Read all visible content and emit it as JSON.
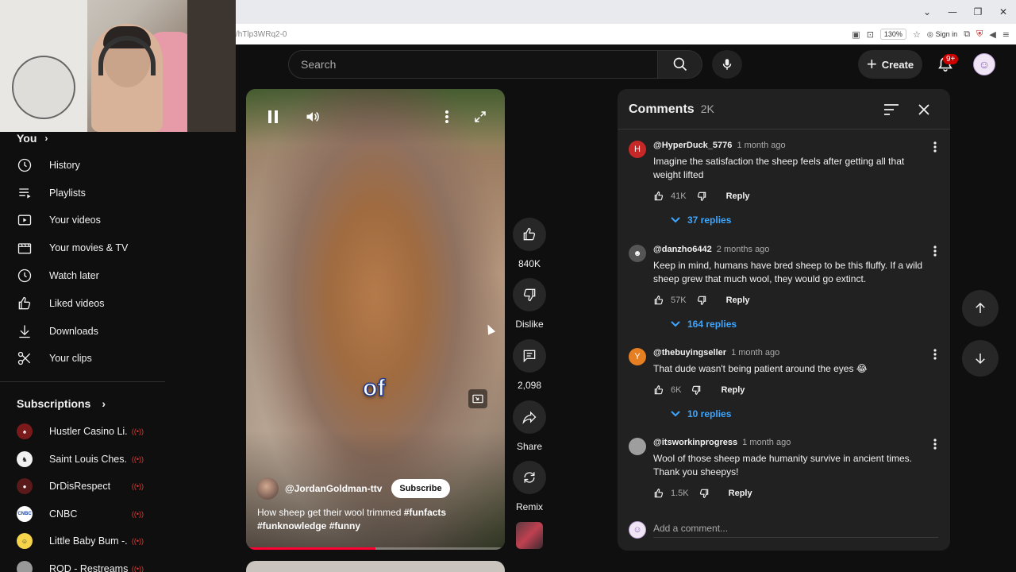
{
  "browser": {
    "url": "/hTlp3WRq2-0",
    "zoom": "130%",
    "sign_in": "Sign in"
  },
  "header": {
    "search_placeholder": "Search",
    "create_label": "Create",
    "notifications_badge": "9+"
  },
  "sidebar": {
    "you_label": "You",
    "items": [
      {
        "label": "History",
        "icon": "history-icon"
      },
      {
        "label": "Playlists",
        "icon": "playlists-icon"
      },
      {
        "label": "Your videos",
        "icon": "your-videos-icon"
      },
      {
        "label": "Your movies & TV",
        "icon": "movies-icon"
      },
      {
        "label": "Watch later",
        "icon": "clock-icon"
      },
      {
        "label": "Liked videos",
        "icon": "thumbs-up-icon"
      },
      {
        "label": "Downloads",
        "icon": "download-icon"
      },
      {
        "label": "Your clips",
        "icon": "scissors-icon"
      }
    ],
    "subscriptions_label": "Subscriptions",
    "subscriptions": [
      {
        "name": "Hustler Casino Li...",
        "color": "#7a1a1a"
      },
      {
        "name": "Saint Louis Ches...",
        "color": "#f1f1f1"
      },
      {
        "name": "DrDisRespect",
        "color": "#5a1a1a"
      },
      {
        "name": "CNBC",
        "color": "#ffffff"
      },
      {
        "name": "Little Baby Bum -...",
        "color": "#f5d34a"
      },
      {
        "name": "ROD - Restreams",
        "color": "#999999"
      }
    ]
  },
  "video": {
    "caption": "of",
    "channel": "@JordanGoldman-ttv",
    "subscribe_label": "Subscribe",
    "title_text": "How sheep get their wool trimmed ",
    "hashtag1": "#funfacts",
    "hashtag2": "#funknowledge",
    "hashtag3": "#funny",
    "progress": 0.5
  },
  "actions": {
    "likes": "840K",
    "dislike_label": "Dislike",
    "comments": "2,098",
    "share_label": "Share",
    "remix_label": "Remix"
  },
  "comments_panel": {
    "title": "Comments",
    "count": "2K",
    "add_placeholder": "Add a comment...",
    "comments": [
      {
        "author": "@HyperDuck_5776",
        "time": "1 month ago",
        "text": "Imagine the satisfaction the sheep feels after getting all that weight lifted",
        "likes": "41K",
        "reply_label": "Reply",
        "replies": "37 replies",
        "avatar_letter": "H",
        "avatar_color": "#c62828"
      },
      {
        "author": "@danzho6442",
        "time": "2 months ago",
        "text": "Keep in mind, humans have bred sheep to be this fluffy. If a wild sheep grew that much wool, they would go extinct.",
        "likes": "57K",
        "reply_label": "Reply",
        "replies": "164 replies",
        "avatar_letter": "",
        "avatar_color": "#555555"
      },
      {
        "author": "@thebuyingseller",
        "time": "1 month ago",
        "text": "That dude wasn't being patient around the eyes 😂",
        "likes": "6K",
        "reply_label": "Reply",
        "replies": "10 replies",
        "avatar_letter": "Y",
        "avatar_color": "#e67e22"
      },
      {
        "author": "@itsworkinprogress",
        "time": "1 month ago",
        "text": "Wool of those sheep made humanity survive in ancient times. Thank you sheepys!",
        "likes": "1.5K",
        "reply_label": "Reply",
        "replies": "",
        "avatar_letter": "",
        "avatar_color": "#9e9e9e"
      }
    ]
  }
}
